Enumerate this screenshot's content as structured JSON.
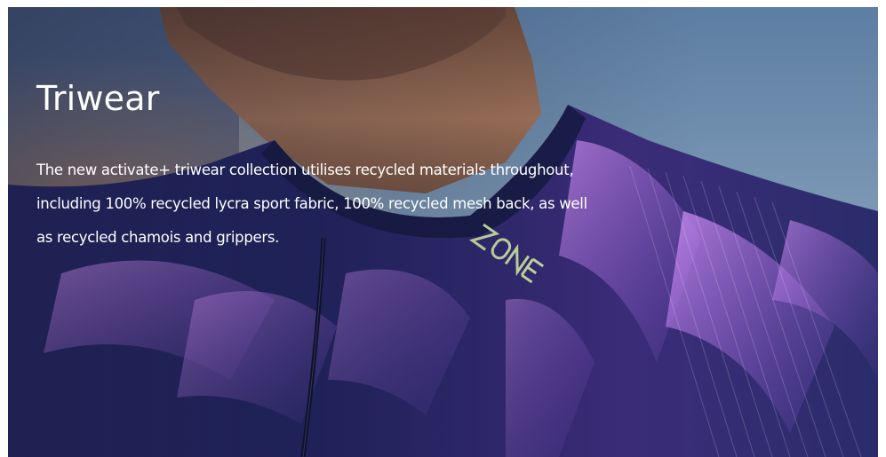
{
  "hero": {
    "title": "Triwear",
    "description": "The new activate+ triwear collection utilises recycled materials throughout, including 100% recycled lycra sport fabric, 100% recycled mesh back, as well as recycled chamois and grippers.",
    "image_logo_text": "ZONE3"
  },
  "colors": {
    "sky": "#6f8fb0",
    "jersey_navy": "#1b2356",
    "jersey_purple": "#8a55c8",
    "skin": "#9b6e55",
    "logo_green": "#cfe3a6",
    "text": "#ffffff"
  }
}
